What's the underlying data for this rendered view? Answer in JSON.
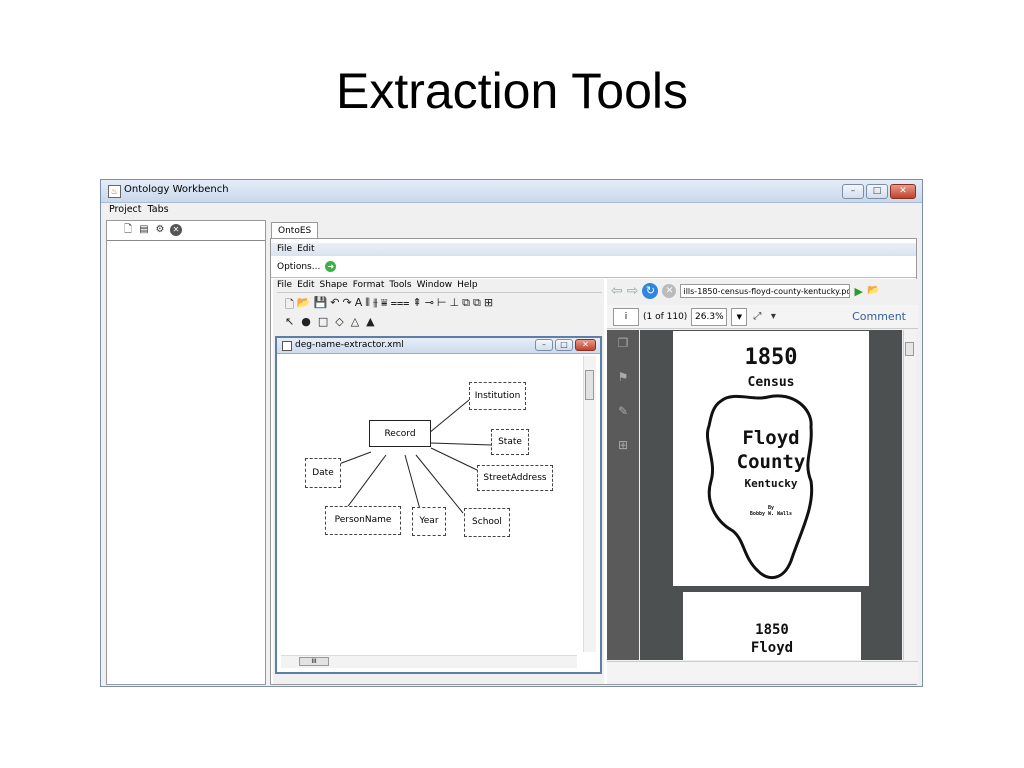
{
  "slide": {
    "title": "Extraction Tools"
  },
  "window": {
    "title": "Ontology Workbench",
    "menu": [
      "Project",
      "Tabs"
    ],
    "controls": {
      "minimize": "–",
      "maximize": "□",
      "close": "✕"
    }
  },
  "left_panel": {
    "toolbar_icons": [
      "new-project-icon",
      "open-project-icon",
      "settings-icon",
      "close-circle-icon"
    ]
  },
  "ontoes": {
    "tab_label": "OntoES",
    "menu": [
      "File",
      "Edit"
    ],
    "options_label": "Options..."
  },
  "editor": {
    "menu": [
      "File",
      "Edit",
      "Shape",
      "Format",
      "Tools",
      "Window",
      "Help"
    ],
    "toolbar_glyphs": [
      "🗋",
      "📂",
      "💾",
      "↶",
      "↷",
      "A",
      "⫴",
      "⫵",
      "⩸",
      "⩶",
      "⇞",
      "⊸",
      "⊢",
      "⊥",
      "⧉",
      "⧉",
      "⊞"
    ],
    "shape_glyphs": [
      "↖",
      "●",
      "□",
      "◇",
      "△",
      "▲"
    ],
    "doc_title": "deg-name-extractor.xml",
    "nodes": {
      "record": "Record",
      "institution": "Institution",
      "state": "State",
      "date": "Date",
      "street_address": "StreetAddress",
      "person_name": "PersonName",
      "year": "Year",
      "school": "School"
    },
    "scroll_thumb": "III"
  },
  "pdf_viewer": {
    "url": "ills-1850-census-floyd-county-kentucky.pdf",
    "page_input": "i",
    "page_count": "(1 of 110)",
    "zoom": "26.3%",
    "comment_label": "Comment",
    "page1": {
      "year": "1850",
      "census": "Census",
      "line1": "Floyd",
      "line2": "County",
      "line3": "Kentucky",
      "by": "By",
      "author": "Bobby W. Walls"
    },
    "page2": {
      "year": "1850",
      "line1": "Floyd"
    }
  },
  "colors": {
    "title_gradient_top": "#e4edf8",
    "editor_border": "#5e7ea6",
    "comment": "#345f9a"
  }
}
